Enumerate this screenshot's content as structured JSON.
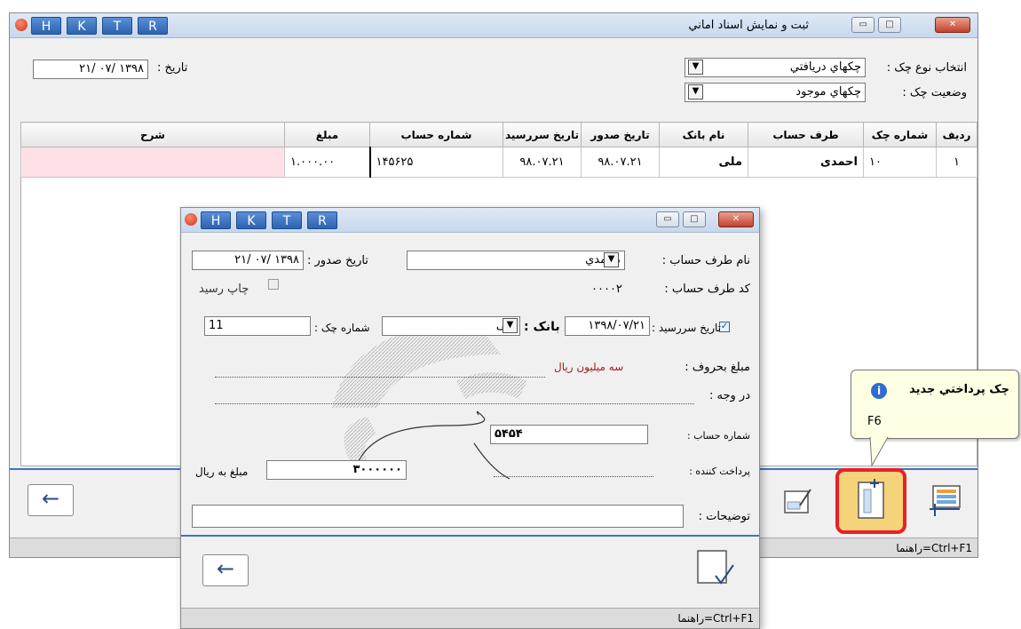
{
  "main_window": {
    "title": "ثبت و نمايش اسناد اماني",
    "hk_buttons": [
      "H",
      "K",
      "T",
      "R"
    ],
    "date_label": "تاريخ :",
    "date_value": "١٣٩٨ /٠٧ /٢١",
    "check_type_label": "انتخاب نوع چک :",
    "check_type_value": "چکهاي دريافتي",
    "check_status_label": "وضعيت چک :",
    "check_status_value": "چکهاي موجود",
    "table": {
      "headers": [
        "رديف",
        "شماره چک",
        "طرف حساب",
        "نام بانک",
        "تاريخ صدور",
        "تاريخ سررسيد",
        "شماره حساب",
        "مبلغ",
        "شرح"
      ],
      "rows": [
        [
          "١",
          "١٠",
          "احمدی",
          "ملی",
          "٩٨.٠٧.٢١",
          "٩٨.٠٧.٢١",
          "١۴۵۶٢۵",
          "١.٠٠٠.٠٠",
          ""
        ]
      ]
    },
    "status_text": "راهنما=Ctrl+F1"
  },
  "dialog": {
    "hk_buttons": [
      "H",
      "K",
      "T",
      "R"
    ],
    "party_name_label": "نام طرف حساب :",
    "party_name_value": "محمدي",
    "party_code_label": "کد طرف حساب :",
    "party_code_value": "٠٠٠٠٢",
    "issue_date_label": "تاريخ صدور :",
    "issue_date_value": "١٣٩٨ /٠٧ /٢١",
    "print_receipt_label": "چاپ رسيد",
    "due_date_label": "تاريخ سررسيد :",
    "due_date_value": "١٣٩٨/٠٧/٢١",
    "bank_label": "بانک :",
    "bank_value": "ملی",
    "check_number_label": "شماره چک :",
    "check_number_value": "11",
    "amount_words_label": "مبلغ بحروف :",
    "amount_words_value": "سه ميليون ريال",
    "pay_to_label": "در وجه :",
    "account_number_label": "شماره حساب :",
    "account_number_value": "۵۴۵۴",
    "payer_label": "پرداخت کننده :",
    "amount_rial_label": "مبلغ به ريال",
    "amount_rial_value": "٣٠٠٠٠٠٠",
    "description_label": "توضيحات :",
    "status_text": "راهنما=Ctrl+F1"
  },
  "tooltip": {
    "title": "چک پرداختي جديد",
    "shortcut": "F6"
  },
  "colors": {
    "accent": "#3d74c4",
    "highlight_red": "#e8202a",
    "tooltip_bg": "#ffffe4",
    "pink_cell": "#ffe0e6"
  }
}
